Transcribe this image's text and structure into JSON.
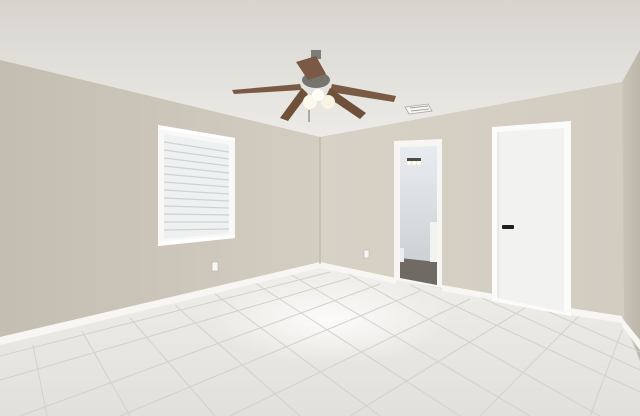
{
  "scene": {
    "description_hidden": false,
    "colors": {
      "ceiling": "#e9e7e2",
      "wall_left": "#cdc7bc",
      "wall_back": "#d6d0c5",
      "wall_right": "#c9c3b8",
      "floor": "#ebe9e4",
      "trim": "#f6f5f2",
      "door": "#f4f4f2",
      "fan_blade": "#7a5a44",
      "fan_metal": "#8c8c88"
    },
    "icons": [
      "ceiling-fan-icon",
      "window-icon",
      "door-icon",
      "outlet-icon",
      "vent-icon"
    ]
  }
}
